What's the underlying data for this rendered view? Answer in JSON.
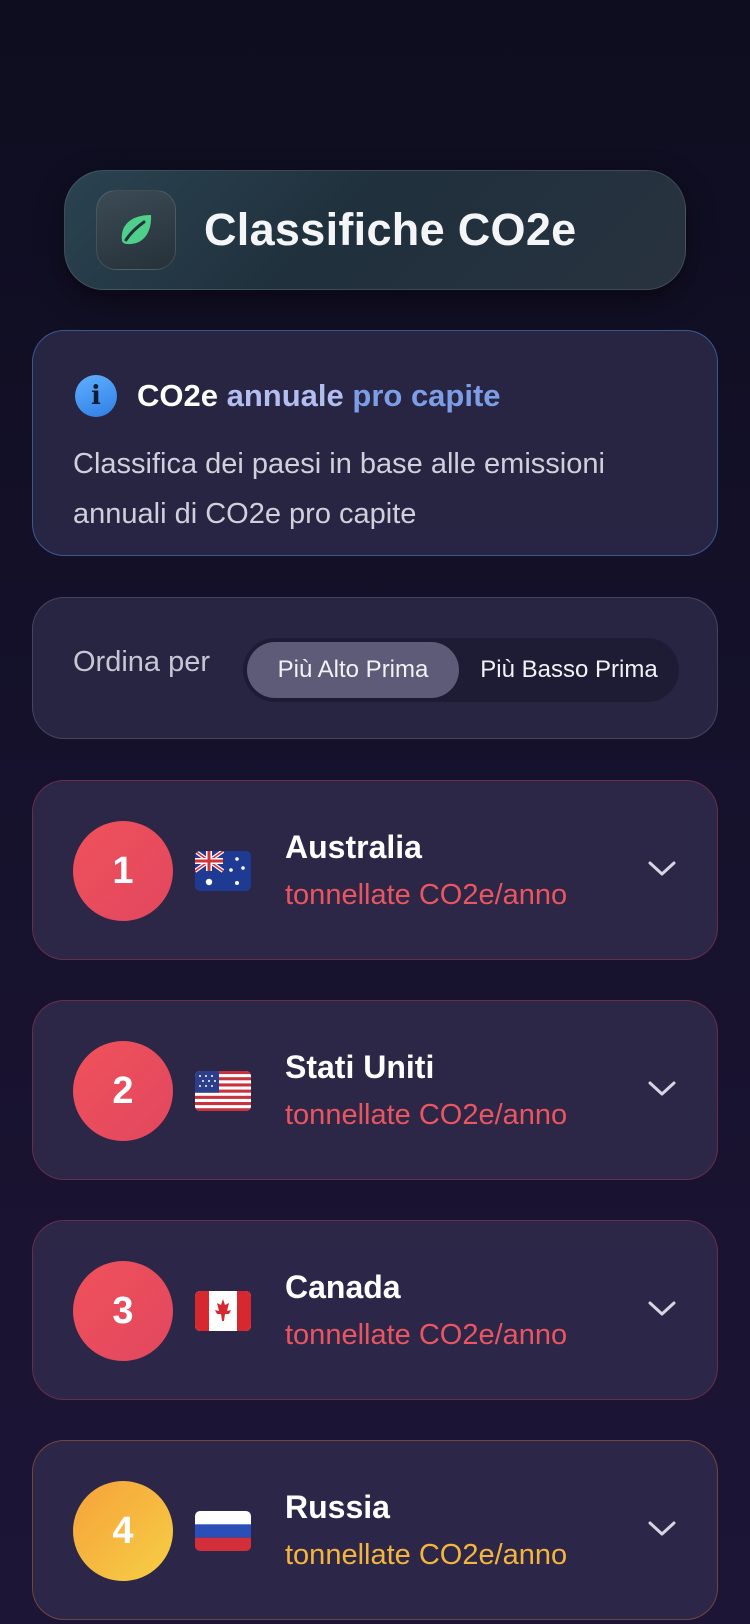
{
  "header": {
    "title": "Classifiche CO2e",
    "icon": "leaf-icon"
  },
  "info": {
    "icon": "info-icon",
    "title_w1": "CO2e",
    "title_w2": "annuale",
    "title_w3": "pro capite",
    "description": "Classifica dei paesi in base alle emissioni annuali di CO2e pro capite"
  },
  "sort": {
    "label": "Ordina per",
    "options": [
      "Più Alto Prima",
      "Più Basso Prima"
    ],
    "selected": "Più Alto Prima"
  },
  "rankings": [
    {
      "rank": "1",
      "country": "Australia",
      "unit": "tonnellate CO2e/anno",
      "flag": "australia-flag",
      "accent": "#eb5560"
    },
    {
      "rank": "2",
      "country": "Stati Uniti",
      "unit": "tonnellate CO2e/anno",
      "flag": "usa-flag",
      "accent": "#eb5560"
    },
    {
      "rank": "3",
      "country": "Canada",
      "unit": "tonnellate CO2e/anno",
      "flag": "canada-flag",
      "accent": "#eb5560"
    },
    {
      "rank": "4",
      "country": "Russia",
      "unit": "tonnellate CO2e/anno",
      "flag": "russia-flag",
      "accent": "#f5b53c"
    }
  ]
}
